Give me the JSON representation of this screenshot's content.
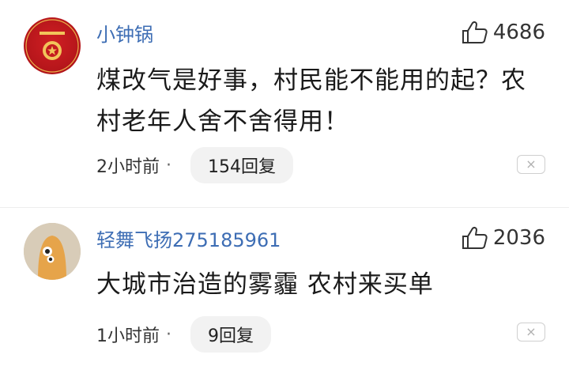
{
  "comments": [
    {
      "username": "小钟锅",
      "likes": "4686",
      "text_line1": "煤改气是好事，村民能不能用的起？农",
      "text_line2": "村老年人舍不舍得用！",
      "time": "2小时前",
      "dot": "·",
      "replies": "154回复",
      "close": "×",
      "avatar_icon": "seal-emblem-icon"
    },
    {
      "username": "轻舞飞扬275185961",
      "likes": "2036",
      "text_line1": "大城市治造的雾霾 农村来买单",
      "time": "1小时前",
      "dot": "·",
      "replies": "9回复",
      "close": "×",
      "avatar_icon": "cartoon-face-icon"
    }
  ],
  "colors": {
    "username": "#3d6db4",
    "text": "#1a1a1a",
    "meta": "#333333",
    "pill_bg": "#f2f2f2"
  }
}
